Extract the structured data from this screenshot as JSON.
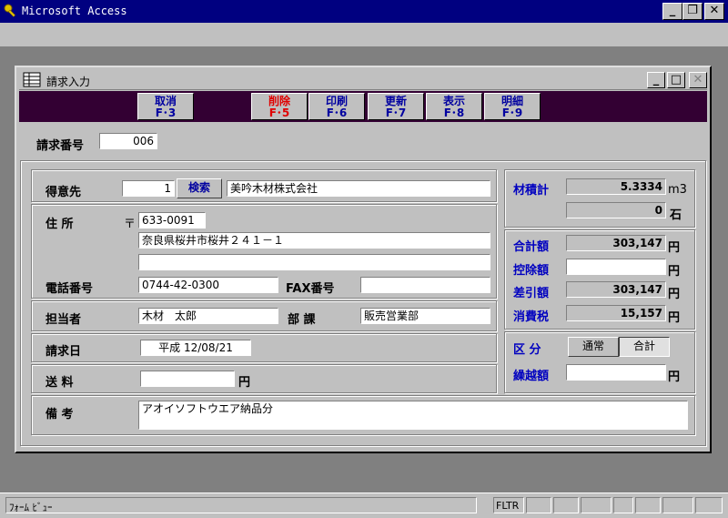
{
  "app": {
    "title": "Microsoft Access"
  },
  "form": {
    "title": "請求入力",
    "toolbar": [
      {
        "label": "取消",
        "key": "F･3",
        "red": false
      },
      {
        "label": "削除",
        "key": "F･5",
        "red": true
      },
      {
        "label": "印刷",
        "key": "F･6",
        "red": false
      },
      {
        "label": "更新",
        "key": "F･7",
        "red": false
      },
      {
        "label": "表示",
        "key": "F･8",
        "red": false
      },
      {
        "label": "明細",
        "key": "F･9",
        "red": false
      }
    ],
    "invoice_no_label": "請求番号",
    "invoice_no": "006",
    "customer_label": "得意先",
    "customer_code": "1",
    "search_button": "検索",
    "customer_name": "美吟木材株式会社",
    "address_label": "住 所",
    "postal_mark": "〒",
    "postal_code": "633-0091",
    "address1": "奈良県桜井市桜井２４１－１",
    "address2": "",
    "phone_label": "電話番号",
    "phone": "0744-42-0300",
    "fax_label": "FAX番号",
    "fax": "",
    "staff_label": "担当者",
    "staff": "木材　太郎",
    "dept_label": "部 課",
    "dept": "販売営業部",
    "bill_date_label": "請求日",
    "bill_date": "平成 12/08/21",
    "shipping_label": "送 料",
    "shipping": "",
    "yen": "円",
    "remarks_label": "備 考",
    "remarks": "アオイソフトウエア納品分",
    "volume_label": "材積計",
    "volume_m3": "5.3334",
    "unit_m3": "m3",
    "volume_koku": "0",
    "unit_koku": "石",
    "total_label": "合計額",
    "total": "303,147",
    "deduction_label": "控除額",
    "deduction": "",
    "net_label": "差引額",
    "net": "303,147",
    "tax_label": "消費税",
    "tax": "15,157",
    "category_label": "区 分",
    "category_normal": "通常",
    "category_total": "合計",
    "carryover_label": "繰越額",
    "carryover": ""
  },
  "status": {
    "view": "ﾌｫｰﾑ ﾋﾞｭｰ",
    "filter": "FLTR"
  }
}
